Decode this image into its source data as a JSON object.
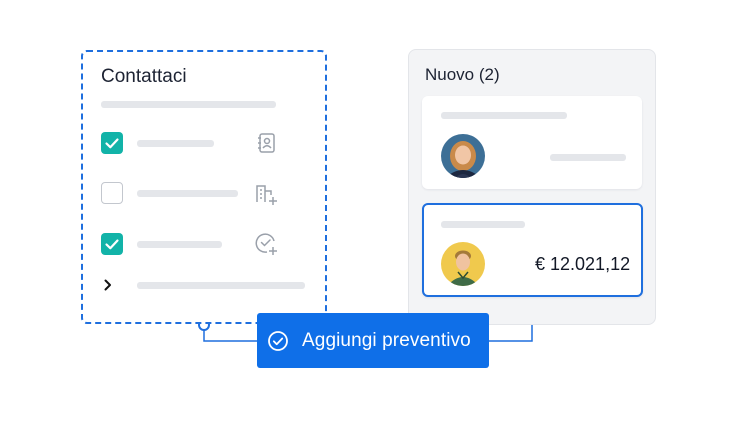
{
  "form": {
    "title": "Contattaci",
    "rows": [
      {
        "checked": true,
        "icon": "contact-book-icon"
      },
      {
        "checked": false,
        "icon": "building-add-icon"
      },
      {
        "checked": true,
        "icon": "check-circle-add-icon"
      }
    ],
    "expand_icon": "chevron-right-icon"
  },
  "column": {
    "title": "Nuovo (2)",
    "cards": [
      {
        "avatar": "woman-avatar",
        "amount": ""
      },
      {
        "avatar": "man-avatar",
        "amount": "€ 12.021,12",
        "selected": true
      }
    ]
  },
  "action": {
    "label": "Aggiungi preventivo",
    "icon": "check-circle-icon"
  },
  "colors": {
    "accent": "#0f6fe8",
    "checkbox": "#12b3a8",
    "skeleton": "#e4e6ea"
  }
}
